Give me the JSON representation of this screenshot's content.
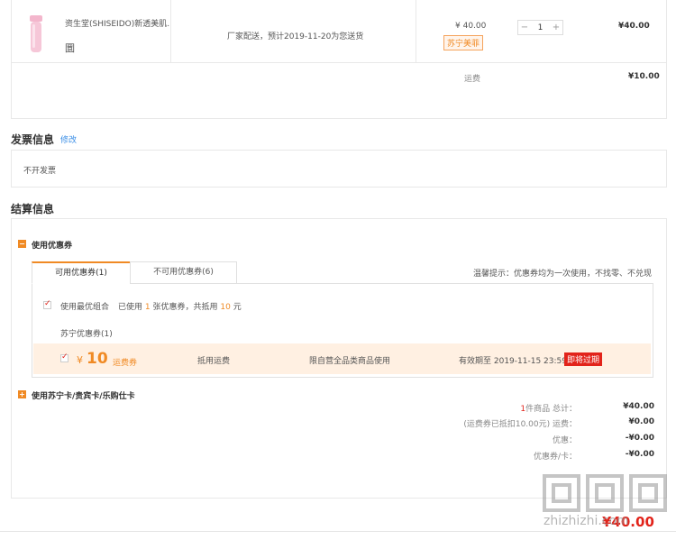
{
  "product": {
    "name": "资生堂(SHISEIDO)新透美肌...",
    "tag_glyph": "圜",
    "delivery": "厂家配送，预计2019-11-20为您送货",
    "unit_price": "¥ 40.00",
    "promo_badge": "苏宁美菲",
    "quantity": "1",
    "qty_minus": "−",
    "qty_plus": "+",
    "row_total": "¥40.00",
    "shipping_label": "运费",
    "shipping_value": "¥10.00"
  },
  "invoice": {
    "title": "发票信息",
    "edit": "修改",
    "value": "不开发票"
  },
  "settlement": {
    "title": "结算信息",
    "coupon_section": "使用优惠券",
    "tabs": [
      {
        "label": "可用优惠券(1)"
      },
      {
        "label": "不可用优惠券(6)"
      }
    ],
    "tip": "温馨提示：优惠券均为一次使用，不找零、不兑现",
    "best_combo_label": "使用最优组合",
    "used_text_a": "已使用",
    "used_count": "1",
    "used_text_b": "张优惠券，共抵用",
    "used_amount": "10",
    "used_text_c": "元",
    "group_label": "苏宁优惠券(1)",
    "coupon": {
      "symbol": "¥",
      "amount": "10",
      "type": "运费券",
      "usage": "抵用运费",
      "scope": "限自营全品类商品使用",
      "expiry": "有效期至 2019-11-15 23:59",
      "badge": "即将过期"
    },
    "card_section": "使用苏宁卡/贵宾卡/乐购仕卡"
  },
  "summary": {
    "item_count": "1",
    "item_text": "件商品 总计：",
    "goods_total": "¥40.00",
    "freight_note": "(运费券已抵扣10.00元) 运费：",
    "freight_value": "¥0.00",
    "discount_label": "优惠：",
    "discount_value": "-¥0.00",
    "coupon_card_label": "优惠券/卡：",
    "coupon_card_value": "-¥0.00",
    "grand_total": "¥40.00"
  },
  "watermark": {
    "text": "zhizhizhi.com"
  },
  "colors": {
    "accent": "#f08a24",
    "red": "#e2231a",
    "link": "#3a8ee6"
  }
}
